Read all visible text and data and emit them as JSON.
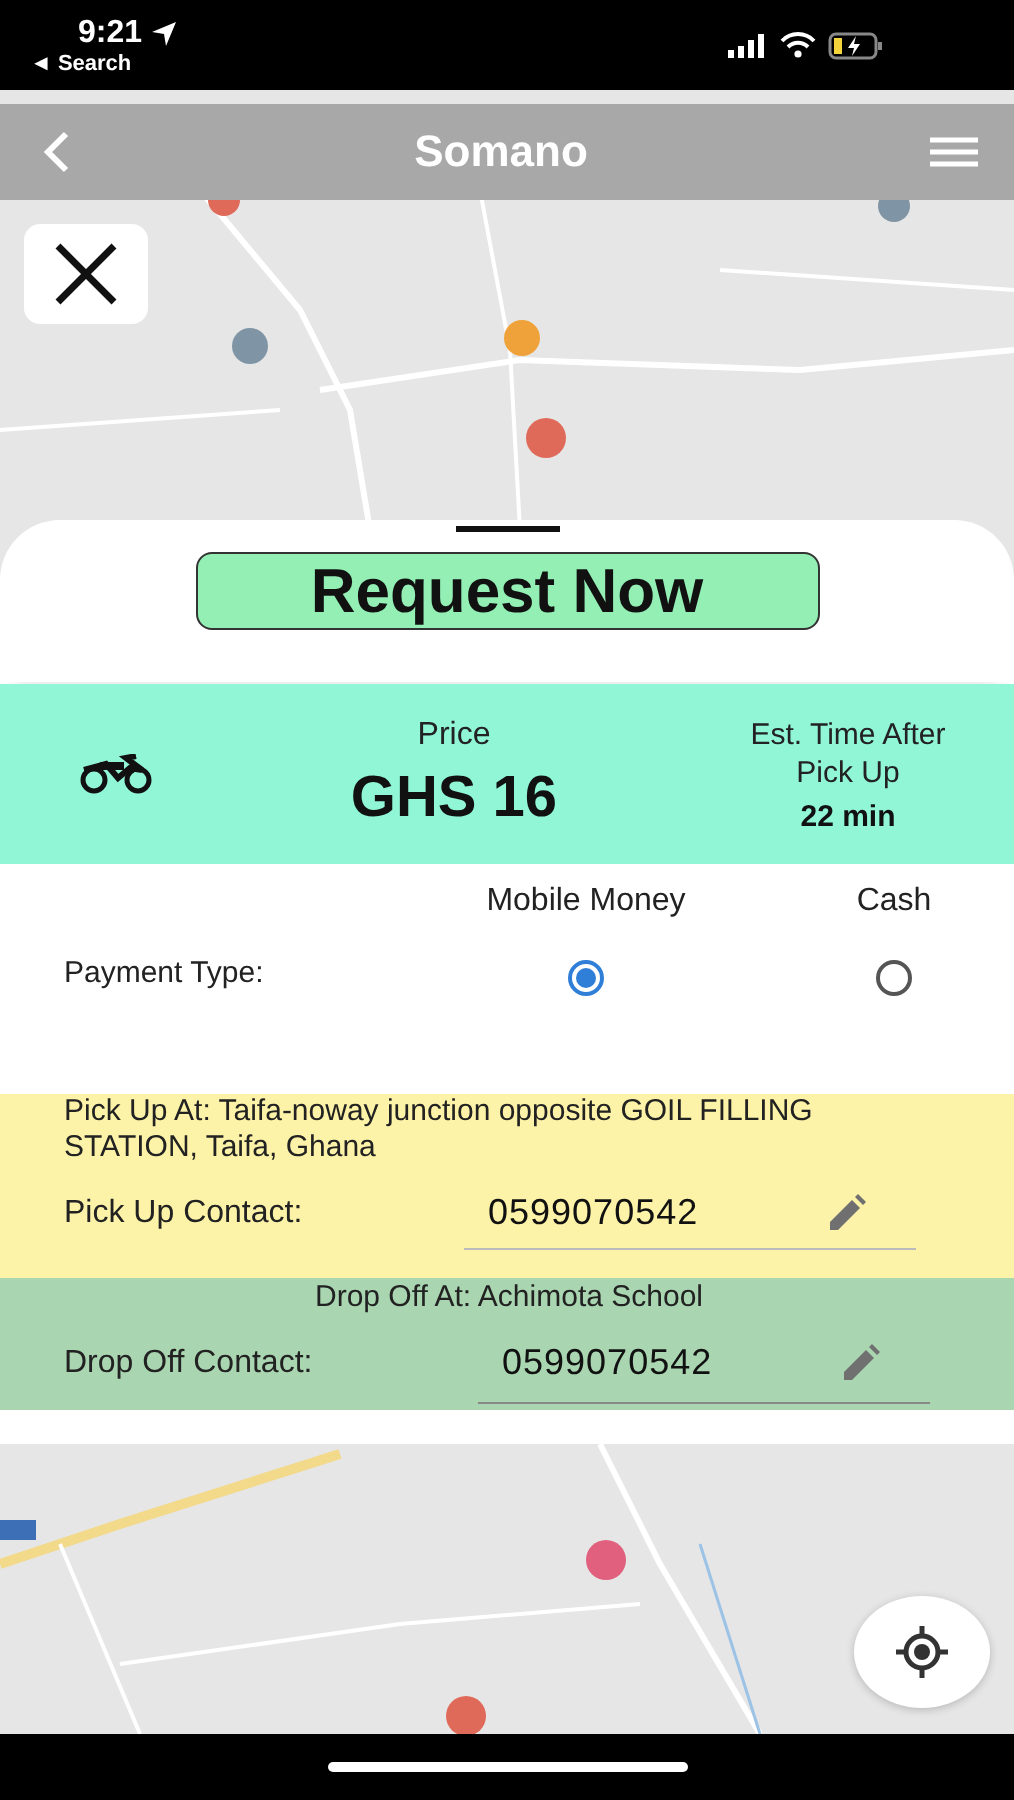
{
  "status_bar": {
    "time": "9:21",
    "back_label": "◄ Search"
  },
  "nav": {
    "title": "Somano"
  },
  "request_button": {
    "label": "Request Now"
  },
  "fare": {
    "price_label": "Price",
    "price": "GHS 16",
    "time_label": "Est. Time After Pick Up",
    "time_value": "22 min"
  },
  "payment": {
    "label": "Payment Type:",
    "options": [
      {
        "label": "Mobile Money",
        "selected": true
      },
      {
        "label": "Cash",
        "selected": false
      }
    ]
  },
  "pickup": {
    "address_line": "Pick Up At:  Taifa-noway junction opposite GOIL FILLING STATION, Taifa, Ghana",
    "contact_label": "Pick Up Contact:",
    "contact": "0599070542"
  },
  "dropoff": {
    "address_line": "Drop Off At:  Achimota School",
    "contact_label": "Drop Off Contact:",
    "contact": "0599070542"
  }
}
